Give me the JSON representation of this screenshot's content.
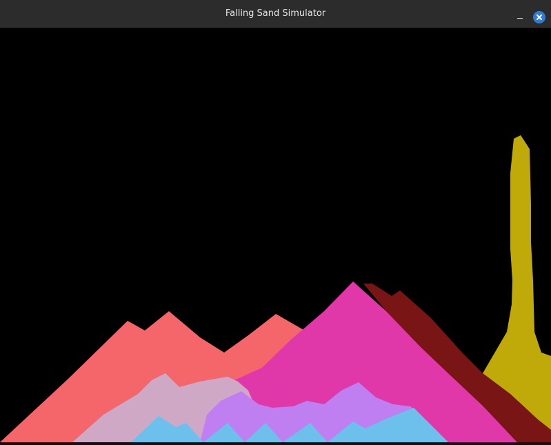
{
  "window": {
    "title": "Falling Sand Simulator"
  },
  "controls": {
    "minimize_icon": "minimize-icon",
    "close_icon": "close-icon"
  },
  "colors": {
    "titlebar": "#2c2c2c",
    "background": "#000000",
    "close_button": "#2f7bd8",
    "sand_coral": "#f5666a",
    "sand_pink": "#cfa8c6",
    "sand_magenta": "#e038a9",
    "sand_violet": "#c07ff0",
    "sand_blue": "#6ec0ec",
    "sand_darkred": "#7a1516",
    "sand_yellow": "#c0aa0a"
  }
}
